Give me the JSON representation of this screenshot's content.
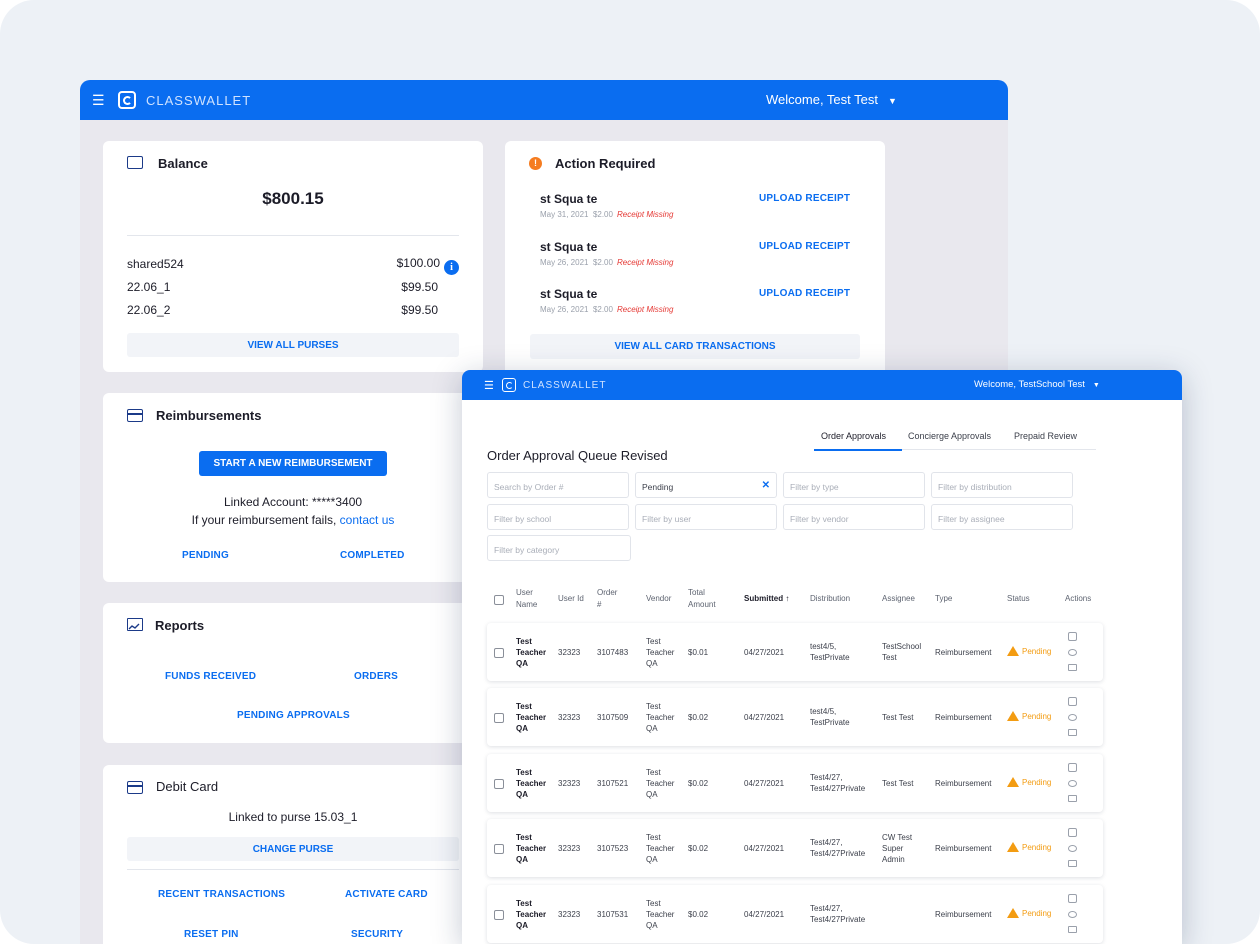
{
  "back_window": {
    "brand": "CLASSWALLET",
    "welcome": "Welcome, Test Test",
    "balance": {
      "title": "Balance",
      "amount": "$800.15",
      "purses": [
        {
          "name": "shared524",
          "amount": "$100.00"
        },
        {
          "name": "22.06_1",
          "amount": "$99.50"
        },
        {
          "name": "22.06_2",
          "amount": "$99.50"
        }
      ],
      "view_all": "VIEW ALL PURSES"
    },
    "action_required": {
      "title": "Action Required",
      "items": [
        {
          "title": "st Squa te",
          "date": "May 31, 2021",
          "amount": "$2.00",
          "note": "Receipt Missing",
          "action": "UPLOAD RECEIPT"
        },
        {
          "title": "st Squa te",
          "date": "May 26, 2021",
          "amount": "$2.00",
          "note": "Receipt Missing",
          "action": "UPLOAD RECEIPT"
        },
        {
          "title": "st Squa te",
          "date": "May 26, 2021",
          "amount": "$2.00",
          "note": "Receipt Missing",
          "action": "UPLOAD RECEIPT"
        }
      ],
      "view_all": "VIEW ALL CARD TRANSACTIONS"
    },
    "reimbursements": {
      "title": "Reimbursements",
      "start_button": "START A NEW REIMBURSEMENT",
      "linked_account": "Linked Account: *****3400",
      "fail_text": "If your reimbursement fails,",
      "contact_link": "contact us",
      "pending": "PENDING",
      "completed": "COMPLETED"
    },
    "reports": {
      "title": "Reports",
      "funds_received": "FUNDS RECEIVED",
      "orders": "ORDERS",
      "pending_approvals": "PENDING APPROVALS"
    },
    "debit_card": {
      "title": "Debit Card",
      "linked_purse": "Linked to purse 15.03_1",
      "change_purse": "CHANGE PURSE",
      "recent_transactions": "RECENT TRANSACTIONS",
      "activate_card": "ACTIVATE CARD",
      "reset_pin": "RESET PIN",
      "security": "SECURITY"
    }
  },
  "front_window": {
    "brand": "CLASSWALLET",
    "welcome": "Welcome, TestSchool Test",
    "tabs": [
      "Order Approvals",
      "Concierge Approvals",
      "Prepaid Review"
    ],
    "title": "Order Approval Queue Revised",
    "filters": {
      "order": "Search by Order #",
      "status": "Pending",
      "type": "Filter by type",
      "distribution": "Filter by distribution",
      "school": "Filter by school",
      "user": "Filter by user",
      "vendor": "Filter by vendor",
      "assignee": "Filter by assignee",
      "category": "Filter by category"
    },
    "columns": {
      "user_name": [
        "User",
        "Name"
      ],
      "user_id": "User Id",
      "order": [
        "Order",
        "#"
      ],
      "vendor": "Vendor",
      "total": [
        "Total",
        "Amount"
      ],
      "submitted": "Submitted ↑",
      "distribution": "Distribution",
      "assignee": "Assignee",
      "type": "Type",
      "status": "Status",
      "actions": "Actions"
    },
    "rows": [
      {
        "user": [
          "Test",
          "Teacher",
          "QA"
        ],
        "user_id": "32323",
        "order": "3107483",
        "vendor": [
          "Test",
          "Teacher",
          "QA"
        ],
        "total": "$0.01",
        "submitted": "04/27/2021",
        "distribution": [
          "test4/5,",
          "TestPrivate"
        ],
        "assignee": [
          "TestSchool",
          "Test"
        ],
        "type": "Reimbursement",
        "status": "Pending"
      },
      {
        "user": [
          "Test",
          "Teacher",
          "QA"
        ],
        "user_id": "32323",
        "order": "3107509",
        "vendor": [
          "Test",
          "Teacher",
          "QA"
        ],
        "total": "$0.02",
        "submitted": "04/27/2021",
        "distribution": [
          "test4/5,",
          "TestPrivate"
        ],
        "assignee": [
          "Test Test"
        ],
        "type": "Reimbursement",
        "status": "Pending"
      },
      {
        "user": [
          "Test",
          "Teacher",
          "QA"
        ],
        "user_id": "32323",
        "order": "3107521",
        "vendor": [
          "Test",
          "Teacher",
          "QA"
        ],
        "total": "$0.02",
        "submitted": "04/27/2021",
        "distribution": [
          "Test4/27,",
          "Test4/27Private"
        ],
        "assignee": [
          "Test Test"
        ],
        "type": "Reimbursement",
        "status": "Pending"
      },
      {
        "user": [
          "Test",
          "Teacher",
          "QA"
        ],
        "user_id": "32323",
        "order": "3107523",
        "vendor": [
          "Test",
          "Teacher",
          "QA"
        ],
        "total": "$0.02",
        "submitted": "04/27/2021",
        "distribution": [
          "Test4/27,",
          "Test4/27Private"
        ],
        "assignee": [
          "CW Test",
          "Super",
          "Admin"
        ],
        "type": "Reimbursement",
        "status": "Pending"
      },
      {
        "user": [
          "Test",
          "Teacher",
          "QA"
        ],
        "user_id": "32323",
        "order": "3107531",
        "vendor": [
          "Test",
          "Teacher",
          "QA"
        ],
        "total": "$0.02",
        "submitted": "04/27/2021",
        "distribution": [
          "Test4/27,",
          "Test4/27Private"
        ],
        "assignee": [],
        "type": "Reimbursement",
        "status": "Pending"
      }
    ]
  },
  "colors": {
    "primary": "#0a6df0",
    "warning": "#f39c12",
    "error": "#e53935"
  }
}
